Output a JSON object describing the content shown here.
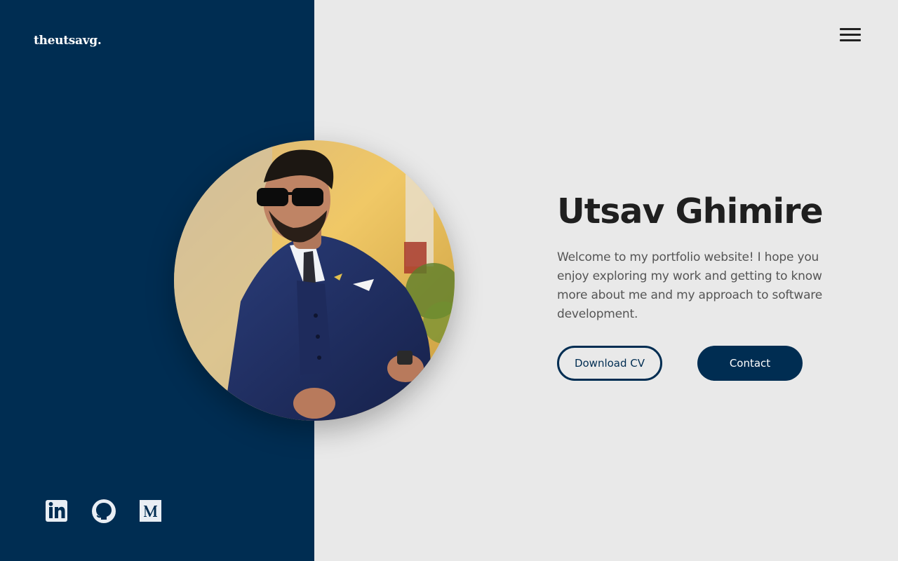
{
  "brand": {
    "logo_text": "theutsavg."
  },
  "header": {
    "menu_icon": "hamburger-menu-icon"
  },
  "hero": {
    "name": "Utsav Ghimire",
    "intro": "Welcome to my portfolio website! I hope you enjoy exploring my work and getting to know more about me and my approach to software development.",
    "download_cv_label": "Download CV",
    "contact_label": "Contact"
  },
  "socials": [
    {
      "icon": "linkedin-icon"
    },
    {
      "icon": "github-icon"
    },
    {
      "icon": "medium-icon"
    }
  ],
  "colors": {
    "primary_navy": "#002d52",
    "background": "#e9e9e9",
    "heading_text": "#1f1f1f",
    "body_text": "#555555"
  }
}
